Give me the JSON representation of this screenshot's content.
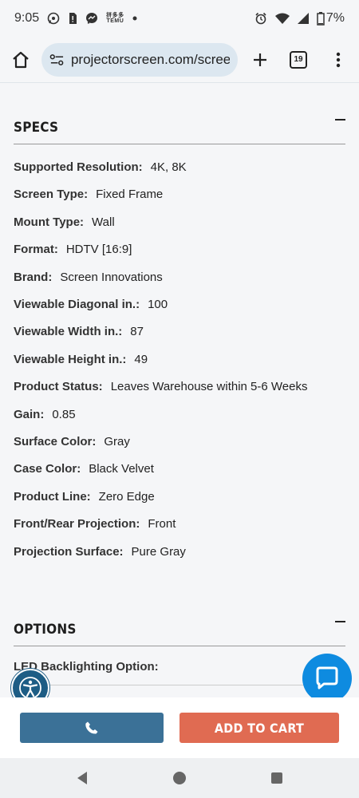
{
  "status": {
    "time": "9:05",
    "battery": "7%",
    "temu_top": "拼多多",
    "temu_bottom": "TEMU"
  },
  "browser": {
    "url": "projectorscreen.com/screen",
    "tab_count": "19"
  },
  "specs": {
    "title": "SPECS",
    "rows": [
      {
        "label": "Supported Resolution:",
        "value": "4K, 8K"
      },
      {
        "label": "Screen Type:",
        "value": "Fixed Frame"
      },
      {
        "label": "Mount Type:",
        "value": "Wall"
      },
      {
        "label": "Format:",
        "value": "HDTV [16:9]"
      },
      {
        "label": "Brand:",
        "value": "Screen Innovations"
      },
      {
        "label": "Viewable Diagonal in.:",
        "value": "100"
      },
      {
        "label": "Viewable Width in.:",
        "value": "87"
      },
      {
        "label": "Viewable Height in.:",
        "value": "49"
      },
      {
        "label": "Product Status:",
        "value": "Leaves Warehouse within 5-6 Weeks"
      },
      {
        "label": "Gain:",
        "value": "0.85"
      },
      {
        "label": "Surface Color:",
        "value": "Gray"
      },
      {
        "label": "Case Color:",
        "value": "Black Velvet"
      },
      {
        "label": "Product Line:",
        "value": "Zero Edge"
      },
      {
        "label": "Front/Rear Projection:",
        "value": "Front"
      },
      {
        "label": "Projection Surface:",
        "value": "Pure Gray"
      }
    ]
  },
  "options": {
    "title": "OPTIONS",
    "first_option_label": "LED Backlighting Option:"
  },
  "actions": {
    "add_to_cart": "ADD TO CART"
  },
  "colors": {
    "phone_button": "#3b7197",
    "cart_button": "#e06b52",
    "chat_bubble": "#0e8be0"
  }
}
